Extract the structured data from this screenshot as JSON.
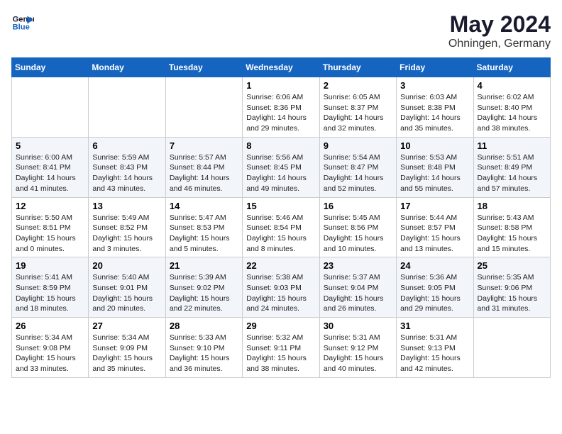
{
  "header": {
    "logo_line1": "General",
    "logo_line2": "Blue",
    "month_year": "May 2024",
    "location": "Ohningen, Germany"
  },
  "weekdays": [
    "Sunday",
    "Monday",
    "Tuesday",
    "Wednesday",
    "Thursday",
    "Friday",
    "Saturday"
  ],
  "weeks": [
    [
      {
        "day": "",
        "info": ""
      },
      {
        "day": "",
        "info": ""
      },
      {
        "day": "",
        "info": ""
      },
      {
        "day": "1",
        "info": "Sunrise: 6:06 AM\nSunset: 8:36 PM\nDaylight: 14 hours\nand 29 minutes."
      },
      {
        "day": "2",
        "info": "Sunrise: 6:05 AM\nSunset: 8:37 PM\nDaylight: 14 hours\nand 32 minutes."
      },
      {
        "day": "3",
        "info": "Sunrise: 6:03 AM\nSunset: 8:38 PM\nDaylight: 14 hours\nand 35 minutes."
      },
      {
        "day": "4",
        "info": "Sunrise: 6:02 AM\nSunset: 8:40 PM\nDaylight: 14 hours\nand 38 minutes."
      }
    ],
    [
      {
        "day": "5",
        "info": "Sunrise: 6:00 AM\nSunset: 8:41 PM\nDaylight: 14 hours\nand 41 minutes."
      },
      {
        "day": "6",
        "info": "Sunrise: 5:59 AM\nSunset: 8:43 PM\nDaylight: 14 hours\nand 43 minutes."
      },
      {
        "day": "7",
        "info": "Sunrise: 5:57 AM\nSunset: 8:44 PM\nDaylight: 14 hours\nand 46 minutes."
      },
      {
        "day": "8",
        "info": "Sunrise: 5:56 AM\nSunset: 8:45 PM\nDaylight: 14 hours\nand 49 minutes."
      },
      {
        "day": "9",
        "info": "Sunrise: 5:54 AM\nSunset: 8:47 PM\nDaylight: 14 hours\nand 52 minutes."
      },
      {
        "day": "10",
        "info": "Sunrise: 5:53 AM\nSunset: 8:48 PM\nDaylight: 14 hours\nand 55 minutes."
      },
      {
        "day": "11",
        "info": "Sunrise: 5:51 AM\nSunset: 8:49 PM\nDaylight: 14 hours\nand 57 minutes."
      }
    ],
    [
      {
        "day": "12",
        "info": "Sunrise: 5:50 AM\nSunset: 8:51 PM\nDaylight: 15 hours\nand 0 minutes."
      },
      {
        "day": "13",
        "info": "Sunrise: 5:49 AM\nSunset: 8:52 PM\nDaylight: 15 hours\nand 3 minutes."
      },
      {
        "day": "14",
        "info": "Sunrise: 5:47 AM\nSunset: 8:53 PM\nDaylight: 15 hours\nand 5 minutes."
      },
      {
        "day": "15",
        "info": "Sunrise: 5:46 AM\nSunset: 8:54 PM\nDaylight: 15 hours\nand 8 minutes."
      },
      {
        "day": "16",
        "info": "Sunrise: 5:45 AM\nSunset: 8:56 PM\nDaylight: 15 hours\nand 10 minutes."
      },
      {
        "day": "17",
        "info": "Sunrise: 5:44 AM\nSunset: 8:57 PM\nDaylight: 15 hours\nand 13 minutes."
      },
      {
        "day": "18",
        "info": "Sunrise: 5:43 AM\nSunset: 8:58 PM\nDaylight: 15 hours\nand 15 minutes."
      }
    ],
    [
      {
        "day": "19",
        "info": "Sunrise: 5:41 AM\nSunset: 8:59 PM\nDaylight: 15 hours\nand 18 minutes."
      },
      {
        "day": "20",
        "info": "Sunrise: 5:40 AM\nSunset: 9:01 PM\nDaylight: 15 hours\nand 20 minutes."
      },
      {
        "day": "21",
        "info": "Sunrise: 5:39 AM\nSunset: 9:02 PM\nDaylight: 15 hours\nand 22 minutes."
      },
      {
        "day": "22",
        "info": "Sunrise: 5:38 AM\nSunset: 9:03 PM\nDaylight: 15 hours\nand 24 minutes."
      },
      {
        "day": "23",
        "info": "Sunrise: 5:37 AM\nSunset: 9:04 PM\nDaylight: 15 hours\nand 26 minutes."
      },
      {
        "day": "24",
        "info": "Sunrise: 5:36 AM\nSunset: 9:05 PM\nDaylight: 15 hours\nand 29 minutes."
      },
      {
        "day": "25",
        "info": "Sunrise: 5:35 AM\nSunset: 9:06 PM\nDaylight: 15 hours\nand 31 minutes."
      }
    ],
    [
      {
        "day": "26",
        "info": "Sunrise: 5:34 AM\nSunset: 9:08 PM\nDaylight: 15 hours\nand 33 minutes."
      },
      {
        "day": "27",
        "info": "Sunrise: 5:34 AM\nSunset: 9:09 PM\nDaylight: 15 hours\nand 35 minutes."
      },
      {
        "day": "28",
        "info": "Sunrise: 5:33 AM\nSunset: 9:10 PM\nDaylight: 15 hours\nand 36 minutes."
      },
      {
        "day": "29",
        "info": "Sunrise: 5:32 AM\nSunset: 9:11 PM\nDaylight: 15 hours\nand 38 minutes."
      },
      {
        "day": "30",
        "info": "Sunrise: 5:31 AM\nSunset: 9:12 PM\nDaylight: 15 hours\nand 40 minutes."
      },
      {
        "day": "31",
        "info": "Sunrise: 5:31 AM\nSunset: 9:13 PM\nDaylight: 15 hours\nand 42 minutes."
      },
      {
        "day": "",
        "info": ""
      }
    ]
  ]
}
